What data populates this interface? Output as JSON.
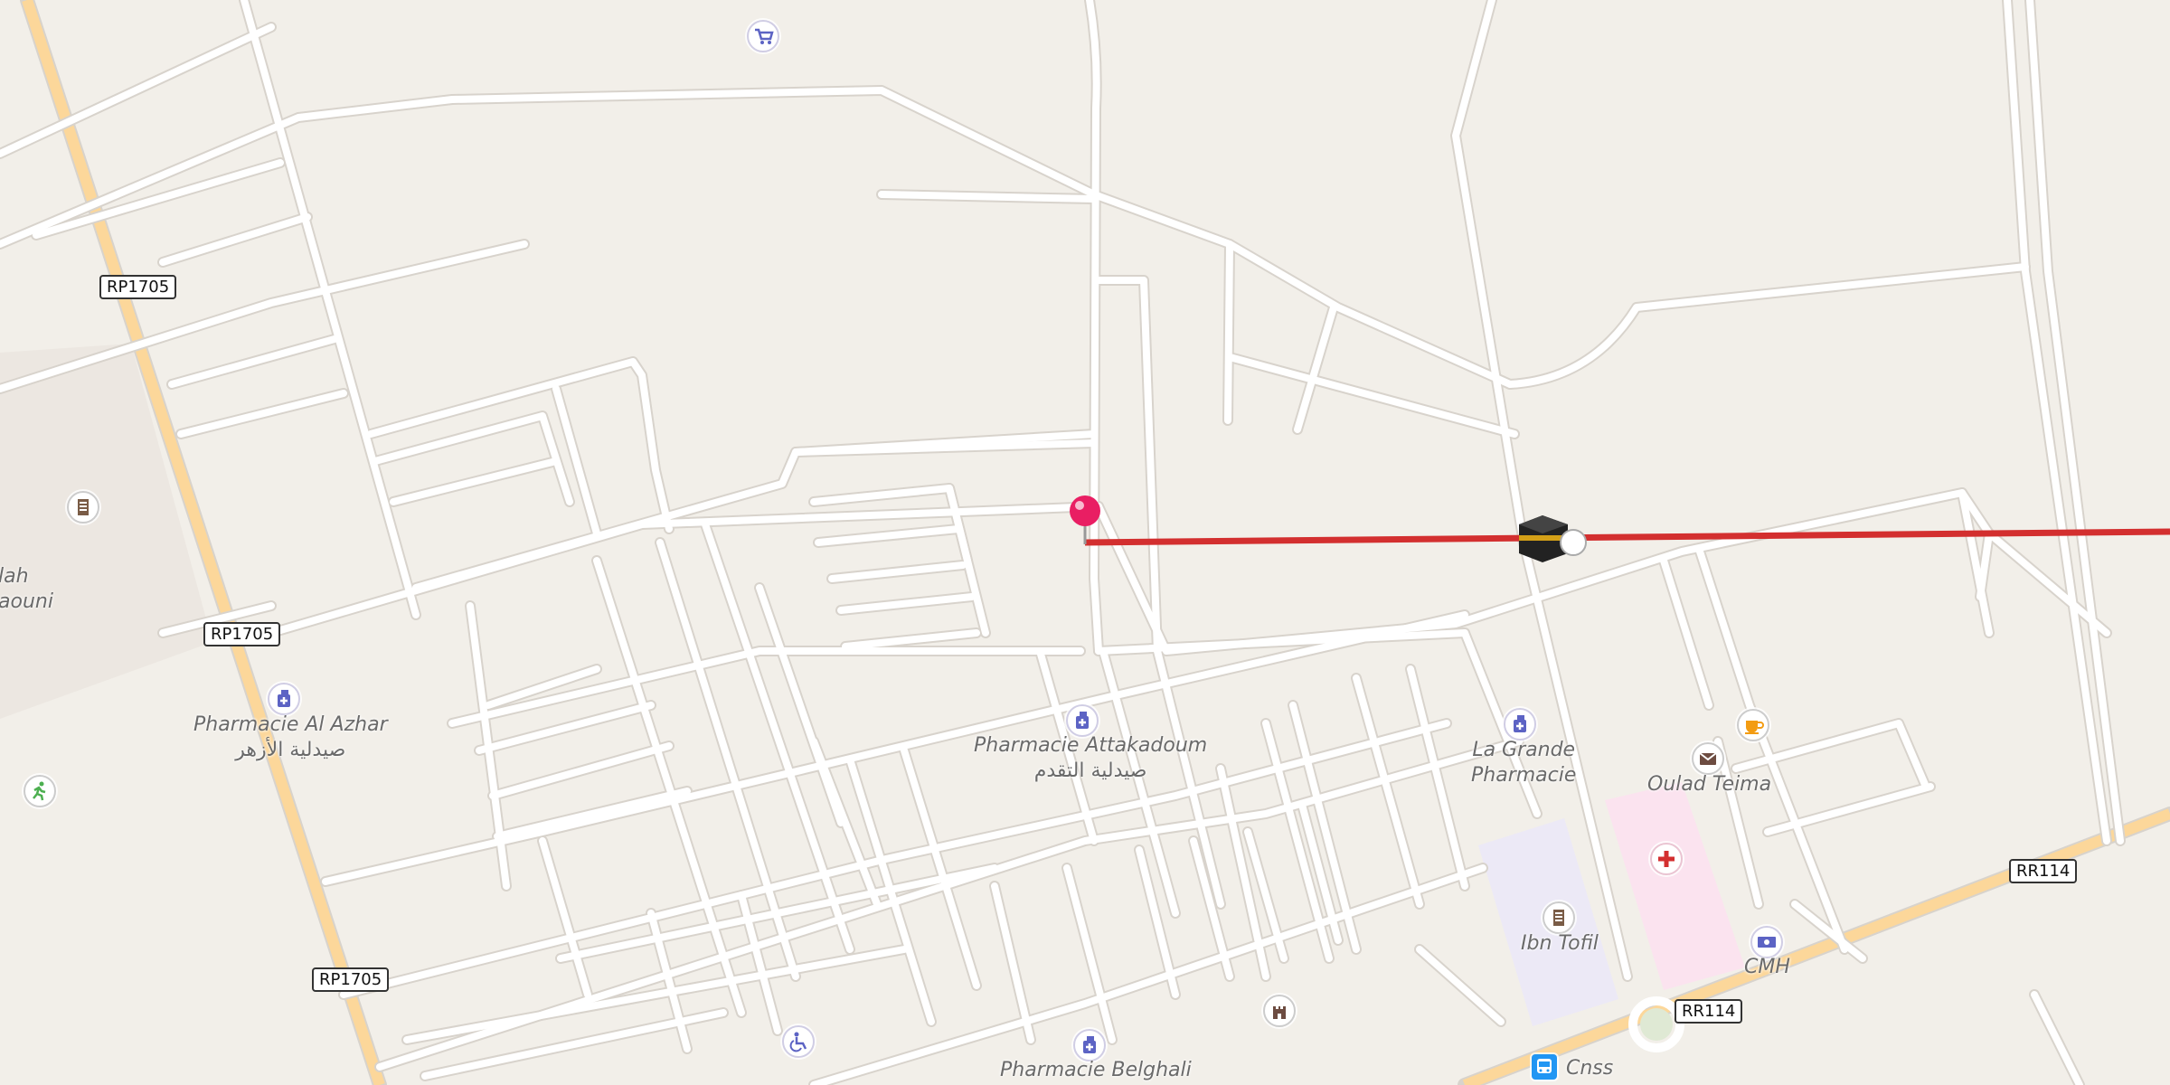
{
  "map": {
    "route_shields": {
      "rp1705_top": "RP1705",
      "rp1705_mid": "RP1705",
      "rp1705_bottom": "RP1705",
      "rr114_right": "RR114",
      "rr114_round": "RR114"
    },
    "places": {
      "pharmacie_al_azhar": {
        "name": "Pharmacie Al Azhar",
        "name_ar": "صيدلية الأزهر"
      },
      "pharmacie_attakadoum": {
        "name": "Pharmacie Attakadoum",
        "name_ar": "صيدلية التقدم"
      },
      "la_grande_pharmacie": {
        "line1": "La Grande",
        "line2": "Pharmacie"
      },
      "oulad_teima": "Oulad Teima",
      "ibn_tofil": "Ibn Tofil",
      "cmh": "CMH",
      "cnss": "Cnss",
      "pharmacie_belghali": "Pharmacie Belghali",
      "partial_left": {
        "line1": "lah",
        "line2": "aouni"
      }
    },
    "route_line_color": "#d32f2f",
    "pin_color": "#e91e63",
    "icons": [
      "cart-icon",
      "school-icon",
      "pharmacy-icon",
      "sport-icon",
      "post-icon",
      "cafe-icon",
      "hospital-icon",
      "bank-icon",
      "tower-icon",
      "disabled-icon",
      "bus-icon",
      "kaaba-icon",
      "location-pin-icon"
    ]
  }
}
